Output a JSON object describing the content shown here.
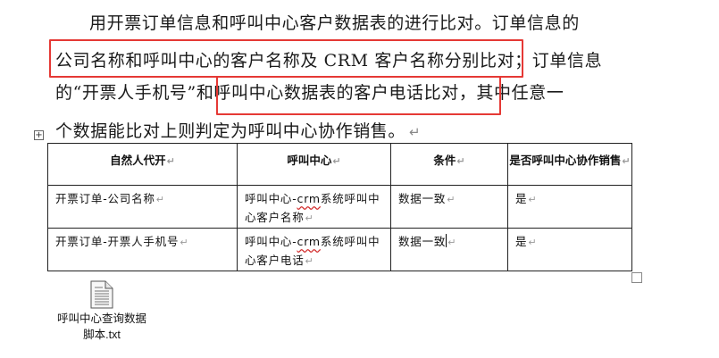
{
  "paragraph": {
    "line1": "用开票订单信息和呼叫中心客户数据表的进行比对。订单信息的",
    "line2": "公司名称和呼叫中心的客户名称及 CRM 客户名称分别比对；订单信息",
    "line3": "的“开票人手机号”和呼叫中心数据表的客户电话比对，其中任意一",
    "line4": "个数据能比对上则判定为呼叫中心协作销售。",
    "end_mark": "↵"
  },
  "table": {
    "move_handle": "+",
    "headers": [
      "自然人代开",
      "呼叫中心",
      "条件",
      "是否呼叫中心协作销售"
    ],
    "cell_mark": "↵",
    "rows": [
      {
        "c1": "开票订单-公司名称",
        "c2_pre": "呼叫中心-",
        "c2_squiggle": "crm",
        "c2_post": "系统呼叫中心客户名称",
        "c3": "数据一致",
        "c4": "是"
      },
      {
        "c1": "开票订单-开票人手机号",
        "c2_pre": "呼叫中心-",
        "c2_squiggle": "crm",
        "c2_post": "系统呼叫中心客户电话",
        "c3": "数据一致",
        "c4": "是"
      }
    ]
  },
  "attachment": {
    "name_line1": "呼叫中心查询数据",
    "name_line2": "脚本.txt",
    "icon": "text-file-icon"
  },
  "colors": {
    "highlight": "#e53935",
    "squiggle": "#d32f2f"
  }
}
